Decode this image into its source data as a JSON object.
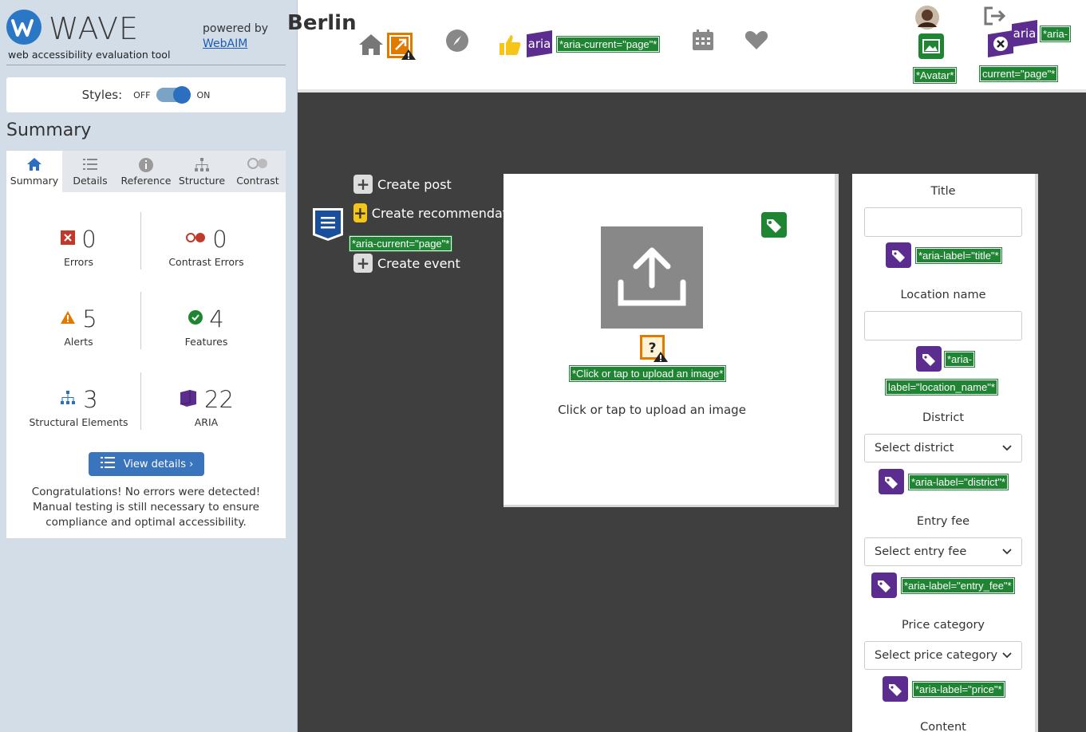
{
  "wave": {
    "logo_text": "WAVE",
    "logo_sub": "web accessibility evaluation tool",
    "powered_by": "powered by",
    "webaim_link": "WebAIM",
    "styles_label": "Styles:",
    "toggle_off": "OFF",
    "toggle_on": "ON",
    "summary_heading": "Summary",
    "tabs": [
      {
        "label": "Summary",
        "icon": "home-icon"
      },
      {
        "label": "Details",
        "icon": "list-icon"
      },
      {
        "label": "Reference",
        "icon": "info-icon"
      },
      {
        "label": "Structure",
        "icon": "hierarchy-icon"
      },
      {
        "label": "Contrast",
        "icon": "contrast-icon"
      }
    ],
    "stats": {
      "errors": {
        "value": "0",
        "label": "Errors"
      },
      "contrast": {
        "value": "0",
        "label": "Contrast Errors"
      },
      "alerts": {
        "value": "5",
        "label": "Alerts"
      },
      "features": {
        "value": "4",
        "label": "Features"
      },
      "structural": {
        "value": "3",
        "label": "Structural Elements"
      },
      "aria": {
        "value": "22",
        "label": "ARIA"
      }
    },
    "view_details": "View details ›",
    "congrats": "Congratulations! No errors were detected! Manual testing is still necessary to ensure compliance and optimal accessibility."
  },
  "page": {
    "brand": "Berlin",
    "labels": {
      "aria_current": "*aria-current=\"page\"*",
      "avatar": "*Avatar*",
      "aria_current_a": "*aria-",
      "aria_current_b": "current=\"page\"*",
      "aria_current_side": "*aria-current=\"page\"*",
      "upload_alt": "*Click or tap to upload an image*",
      "title": "*aria-label=\"title\"*",
      "location_a": "*aria-",
      "location_b": "label=\"location_name\"*",
      "district": "*aria-label=\"district\"*",
      "entry_fee": "*aria-label=\"entry_fee\"*",
      "price": "*aria-label=\"price\"*"
    },
    "aria_badge_text": "aria",
    "actions": {
      "create_post": "Create post",
      "create_recommendation": "Create recommendati",
      "create_event": "Create event"
    },
    "upload_text": "Click or tap to upload an image",
    "form": {
      "title_label": "Title",
      "location_label": "Location name",
      "district_label": "District",
      "district_select": "Select district",
      "entry_label": "Entry fee",
      "entry_select": "Select entry fee",
      "price_label": "Price category",
      "price_select": "Select price category",
      "content_label": "Content"
    }
  },
  "colors": {
    "wave_blue": "#2a6fc0",
    "feature_green": "#1f8533",
    "aria_purple": "#5b2d8e",
    "alert_orange": "#e07b00",
    "error_red": "#c0392b"
  }
}
